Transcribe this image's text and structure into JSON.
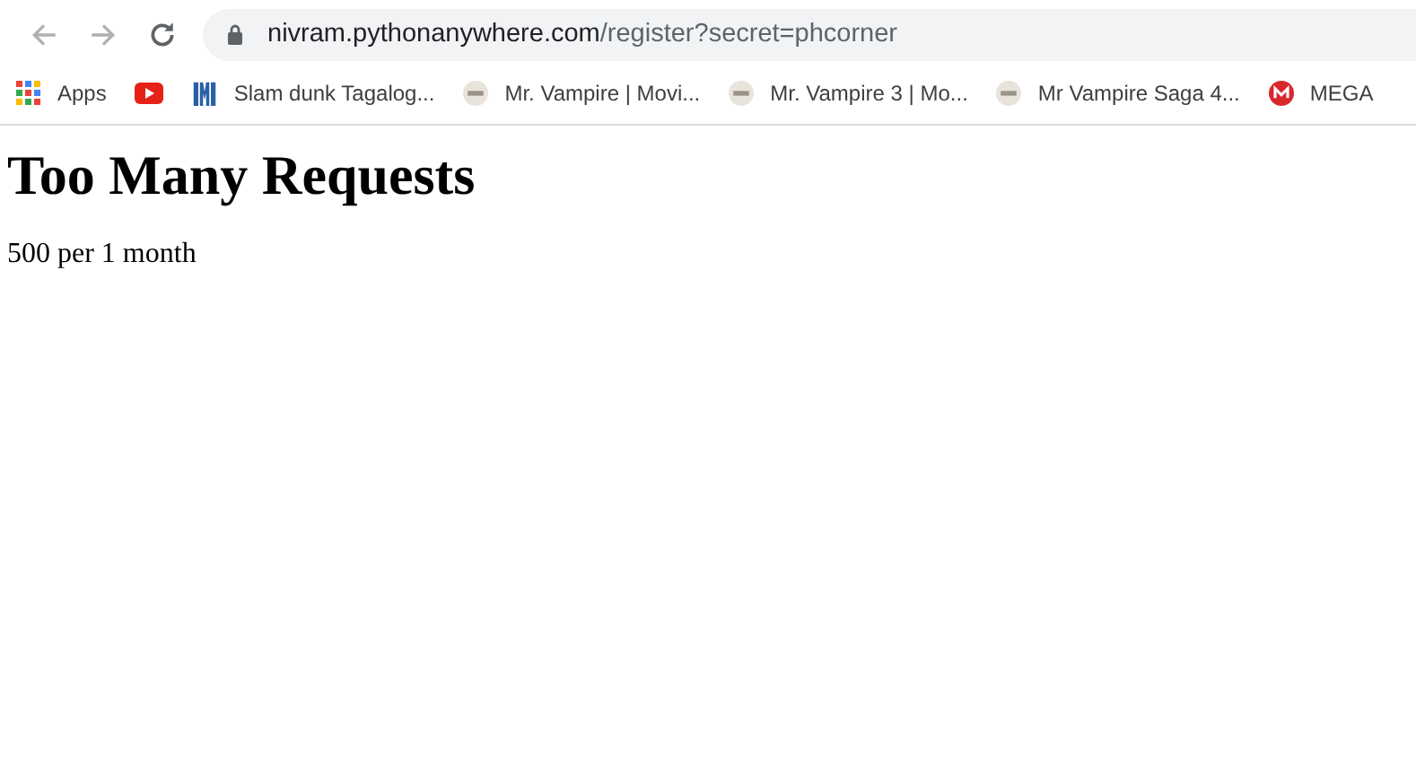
{
  "address_bar": {
    "host": "nivram.pythonanywhere.com",
    "path": "/register?secret=phcorner"
  },
  "bookmarks": [
    {
      "kind": "apps",
      "label": "Apps"
    },
    {
      "kind": "youtube"
    },
    {
      "kind": "logo",
      "label": "Slam dunk Tagalog..."
    },
    {
      "kind": "site",
      "label": "Mr. Vampire | Movi..."
    },
    {
      "kind": "site",
      "label": "Mr. Vampire 3 | Mo..."
    },
    {
      "kind": "site",
      "label": "Mr Vampire Saga 4..."
    },
    {
      "kind": "mega",
      "label": "MEGA"
    }
  ],
  "page": {
    "heading": "Too Many Requests",
    "message": "500 per 1 month"
  }
}
